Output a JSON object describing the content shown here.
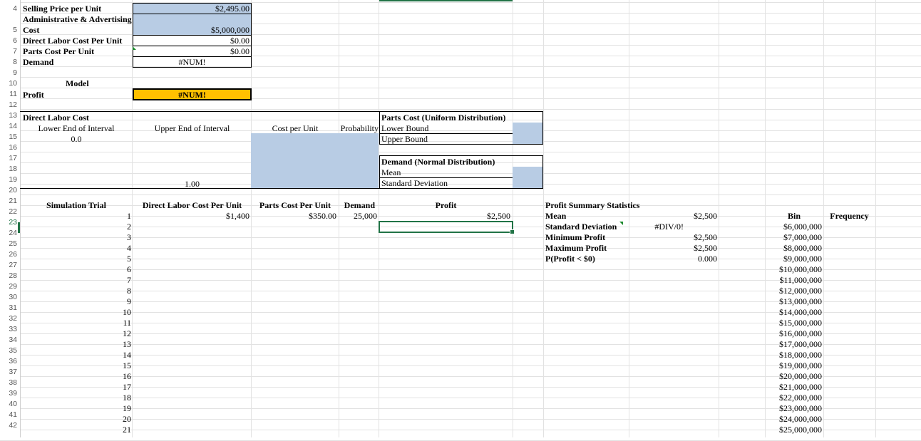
{
  "rows": [
    "4",
    "5",
    "6",
    "7",
    "8",
    "9",
    "10",
    "11",
    "12",
    "13",
    "14",
    "15",
    "16",
    "17",
    "18",
    "19",
    "20",
    "21",
    "22",
    "23",
    "24",
    "25",
    "26",
    "27",
    "28",
    "29",
    "30",
    "31",
    "32",
    "33",
    "34",
    "35",
    "36",
    "37",
    "38",
    "39",
    "40",
    "41",
    "42"
  ],
  "inputs": {
    "selling_price_label": "Selling Price per Unit",
    "selling_price_value": "$2,495.00",
    "admin_label_line1": "Administrative & Advertising",
    "admin_label_line2": "Cost",
    "admin_value": "$5,000,000",
    "labor_label": "Direct Labor Cost Per Unit",
    "labor_value": "$0.00",
    "parts_label": "Parts Cost Per Unit",
    "parts_value": "$0.00",
    "demand_label": "Demand",
    "demand_value": "#NUM!"
  },
  "model": {
    "title": "Model",
    "profit_label": "Profit",
    "profit_value": "#NUM!"
  },
  "labor_table": {
    "title": "Direct Labor Cost",
    "col_lower": "Lower End of Interval",
    "col_upper": "Upper End of Interval",
    "col_cost": "Cost per Unit",
    "col_prob": "Probability",
    "first_lower": "0.0",
    "last_upper": "1.00"
  },
  "parts_table": {
    "title": "Parts Cost (Uniform Distribution)",
    "lower": "Lower Bound",
    "upper": "Upper Bound"
  },
  "demand_table": {
    "title": "Demand (Normal Distribution)",
    "mean": "Mean",
    "sd": "Standard Deviation"
  },
  "simulation": {
    "col_trial": "Simulation Trial",
    "col_labor": "Direct Labor Cost Per Unit",
    "col_parts": "Parts Cost Per Unit",
    "col_demand": "Demand",
    "col_profit": "Profit",
    "trials": [
      "1",
      "2",
      "3",
      "4",
      "5",
      "6",
      "7",
      "8",
      "9",
      "10",
      "11",
      "12",
      "13",
      "14",
      "15",
      "16",
      "17",
      "18",
      "19",
      "20",
      "21"
    ],
    "first_labor": "$1,400",
    "first_parts": "$350.00",
    "first_demand": "25,000",
    "first_profit": "$2,500"
  },
  "stats": {
    "title": "Profit Summary Statistics",
    "labels": [
      "Mean",
      "Standard Deviation",
      "Minimum Profit",
      "Maximum Profit",
      "P(Profit < $0)"
    ],
    "values": [
      "$2,500",
      "#DIV/0!",
      "$2,500",
      "$2,500",
      "0.000"
    ]
  },
  "bins": {
    "col_bin": "Bin",
    "col_freq": "Frequency",
    "values": [
      "$6,000,000",
      "$7,000,000",
      "$8,000,000",
      "$9,000,000",
      "$10,000,000",
      "$11,000,000",
      "$12,000,000",
      "$13,000,000",
      "$14,000,000",
      "$15,000,000",
      "$16,000,000",
      "$17,000,000",
      "$18,000,000",
      "$19,000,000",
      "$20,000,000",
      "$21,000,000",
      "$22,000,000",
      "$23,000,000",
      "$24,000,000",
      "$25,000,000"
    ]
  },
  "colors": {
    "input_blue": "#b8cce4",
    "profit_orange": "#ffc000",
    "excel_green": "#217346"
  }
}
